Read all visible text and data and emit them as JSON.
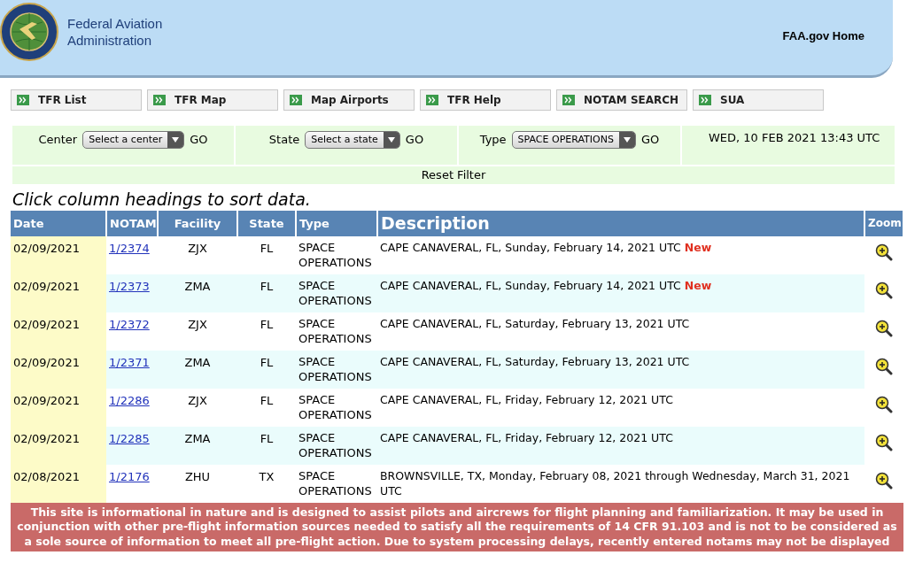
{
  "header": {
    "agency_line1": "Federal Aviation",
    "agency_line2": "Administration",
    "home_link": "FAA.gov Home"
  },
  "nav": [
    "TFR List",
    "TFR Map",
    "Map Airports",
    "TFR Help",
    "NOTAM SEARCH",
    "SUA"
  ],
  "filters": [
    {
      "label": "Center",
      "value": "Select a center",
      "button": "GO"
    },
    {
      "label": "State",
      "value": "Select a state",
      "button": "GO"
    },
    {
      "label": "Type",
      "value": "SPACE OPERATIONS",
      "button": "GO"
    }
  ],
  "timestamp": "WED, 10 FEB 2021 13:43 UTC",
  "reset": "Reset Filter",
  "instructions": "Click column headings to sort data.",
  "table": {
    "columns": [
      "Date",
      "NOTAM",
      "Facility",
      "State",
      "Type",
      "Description",
      "Zoom"
    ],
    "rows": [
      {
        "date": "02/09/2021",
        "notam": "1/2374",
        "facility": "ZJX",
        "state": "FL",
        "type": "SPACE OPERATIONS",
        "description": "CAPE CANAVERAL, FL, Sunday, February 14, 2021 UTC",
        "badge": "New"
      },
      {
        "date": "02/09/2021",
        "notam": "1/2373",
        "facility": "ZMA",
        "state": "FL",
        "type": "SPACE OPERATIONS",
        "description": "CAPE CANAVERAL, FL, Sunday, February 14, 2021 UTC",
        "badge": "New"
      },
      {
        "date": "02/09/2021",
        "notam": "1/2372",
        "facility": "ZJX",
        "state": "FL",
        "type": "SPACE OPERATIONS",
        "description": "CAPE CANAVERAL, FL, Saturday, February 13, 2021 UTC"
      },
      {
        "date": "02/09/2021",
        "notam": "1/2371",
        "facility": "ZMA",
        "state": "FL",
        "type": "SPACE OPERATIONS",
        "description": "CAPE CANAVERAL, FL, Saturday, February 13, 2021 UTC"
      },
      {
        "date": "02/09/2021",
        "notam": "1/2286",
        "facility": "ZJX",
        "state": "FL",
        "type": "SPACE OPERATIONS",
        "description": "CAPE CANAVERAL, FL, Friday, February 12, 2021 UTC"
      },
      {
        "date": "02/09/2021",
        "notam": "1/2285",
        "facility": "ZMA",
        "state": "FL",
        "type": "SPACE OPERATIONS",
        "description": "CAPE CANAVERAL, FL, Friday, February 12, 2021 UTC"
      },
      {
        "date": "02/08/2021",
        "notam": "1/2176",
        "facility": "ZHU",
        "state": "TX",
        "type": "SPACE OPERATIONS",
        "description": "BROWNSVILLE, TX, Monday, February 08, 2021 through Wednesday, March 31, 2021 UTC"
      }
    ]
  },
  "disclaimer": "This site is informational in nature and is designed to assist pilots and aircrews for flight planning and familiarization. It may be used in conjunction with other pre-flight information sources needed to satisfy all the requirements of 14 CFR 91.103 and is not to be considered as a sole source of information to meet all pre-flight action. Due to system processing delays, recently entered notams may not be displayed"
}
